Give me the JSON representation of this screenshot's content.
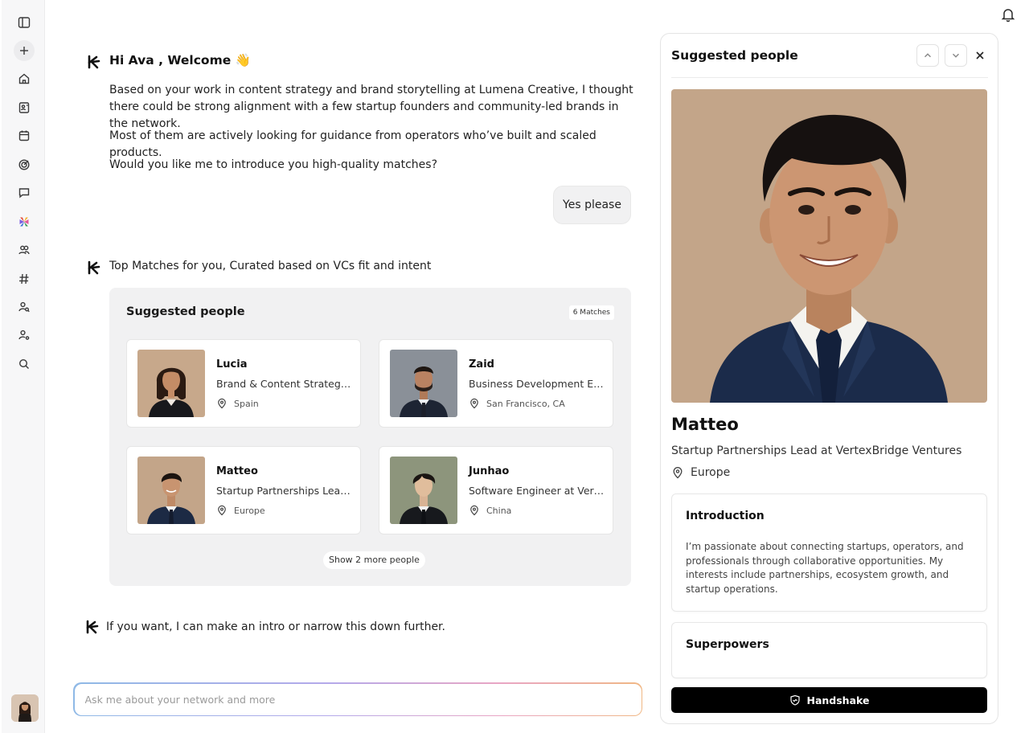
{
  "sidebar": {
    "items": [
      {
        "icon": "sidebar-toggle-icon"
      },
      {
        "icon": "plus-icon"
      },
      {
        "icon": "home-icon"
      },
      {
        "icon": "contacts-icon"
      },
      {
        "icon": "calendar-icon"
      },
      {
        "icon": "target-icon"
      },
      {
        "icon": "chat-icon"
      },
      {
        "icon": "app-logo-icon"
      },
      {
        "icon": "people-icon"
      },
      {
        "icon": "hashtag-icon"
      },
      {
        "icon": "user-search-icon"
      },
      {
        "icon": "user-settings-icon"
      },
      {
        "icon": "search-icon"
      }
    ]
  },
  "chat": {
    "greeting": "Hi Ava , Welcome 👋",
    "paragraphs": [
      "Based on your work in content strategy and brand storytelling at Lumena Creative, I thought there could be strong alignment with a few startup founders and community-led brands in the network.",
      "Most of them are actively looking for guidance from operators who’ve built and scaled products.",
      "Would you like me to introduce you high-quality matches?"
    ],
    "user_reply": "Yes please",
    "matches_intro": "Top Matches for you, Curated based on VCs fit and intent",
    "closing": "If you want, I can make an intro or narrow this down further."
  },
  "matches": {
    "title": "Suggested people",
    "badge": "6 Matches",
    "people": [
      {
        "name": "Lucia",
        "role": "Brand & Content Strategist at Lumena Creative",
        "location": "Spain"
      },
      {
        "name": "Zaid",
        "role": "Business Development Executive",
        "location": "San Francisco, CA"
      },
      {
        "name": "Matteo",
        "role": "Startup Partnerships Lead at VertexBridge Ventures",
        "location": "Europe"
      },
      {
        "name": "Junhao",
        "role": "Software Engineer at VertexBridge",
        "location": "China"
      }
    ],
    "show_more": "Show 2 more people"
  },
  "input": {
    "placeholder": "Ask me about your network and more"
  },
  "detail": {
    "title": "Suggested people",
    "name": "Matteo",
    "role": "Startup Partnerships Lead at VertexBridge Ventures",
    "location": "Europe",
    "intro_title": "Introduction",
    "intro_body": "I’m passionate about connecting startups, operators, and professionals through collaborative opportunities. My interests include partnerships, ecosystem growth, and startup operations.",
    "superpowers_title": "Superpowers",
    "handshake_label": "Handshake"
  },
  "colors": {
    "accent": "#000000",
    "panel_bg": "#f1f1f2",
    "portrait_bg": "#c3a589"
  }
}
